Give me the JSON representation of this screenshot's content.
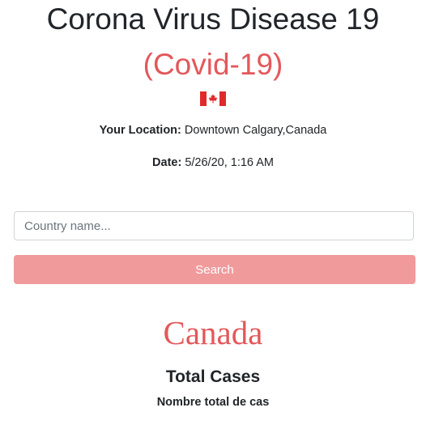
{
  "header": {
    "title": "Corona Virus Disease 19",
    "subtitle": "(Covid-19)",
    "flag_icon": "canada-flag-icon"
  },
  "location": {
    "label": "Your Location:",
    "value": " Downtown Calgary,Canada"
  },
  "date": {
    "label": "Date:",
    "value": " 5/26/20, 1:16 AM"
  },
  "search": {
    "placeholder": "Country name...",
    "value": "",
    "button_label": "Search"
  },
  "result": {
    "country": "Canada",
    "total_cases_label": "Total Cases",
    "total_cases_label_fr": "Nombre total de cas"
  },
  "colors": {
    "accent": "#e3585b",
    "button_bg": "#f09a9c",
    "text": "#212529"
  }
}
